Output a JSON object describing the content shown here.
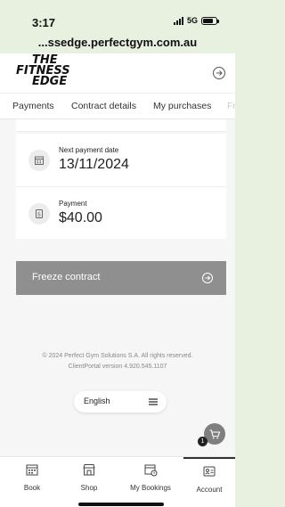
{
  "status_bar": {
    "time": "3:17",
    "network": "5G"
  },
  "browser": {
    "url": "...ssedge.perfectgym.com.au"
  },
  "header": {
    "logo_line1": "THE",
    "logo_line2": "FITNESS",
    "logo_line3": "EDGE"
  },
  "tabs": [
    {
      "label": "Payments"
    },
    {
      "label": "Contract details"
    },
    {
      "label": "My purchases"
    },
    {
      "label": "Fr"
    }
  ],
  "payment_info": {
    "next_payment_label": "Next payment date",
    "next_payment_value": "13/11/2024",
    "payment_label": "Payment",
    "payment_value": "$40.00"
  },
  "freeze": {
    "label": "Freeze contract"
  },
  "footer": {
    "copyright": "© 2024 Perfect Gym Solutions S.A. All rights reserved.",
    "version": "ClientPortal version 4.920.545.1107"
  },
  "language": {
    "label": "English"
  },
  "cart": {
    "badge_count": "1"
  },
  "bottom_nav": [
    {
      "label": "Book",
      "icon": "calendar-icon"
    },
    {
      "label": "Shop",
      "icon": "shop-icon"
    },
    {
      "label": "My Bookings",
      "icon": "bookings-icon"
    },
    {
      "label": "Account",
      "icon": "account-icon"
    }
  ],
  "colors": {
    "accent": "#8f8f8f",
    "background": "#f6f6f6"
  }
}
